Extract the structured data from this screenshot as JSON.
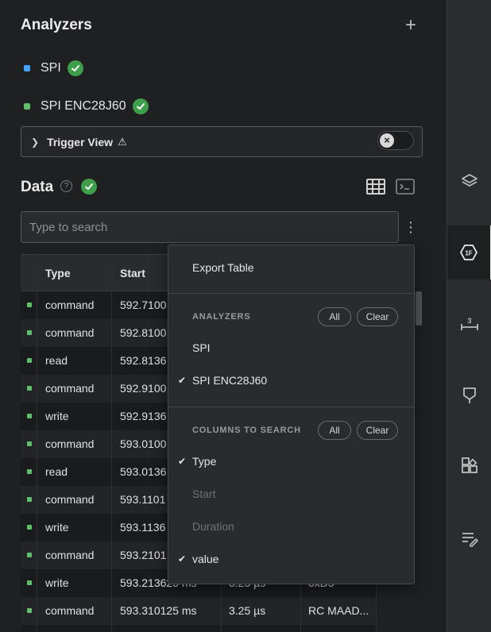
{
  "analyzers": {
    "title": "Analyzers",
    "add_icon": "plus-icon",
    "items": [
      {
        "label": "SPI",
        "color": "#4aa3ff"
      },
      {
        "label": "SPI ENC28J60",
        "color": "#5fbf6a"
      }
    ]
  },
  "trigger_view": {
    "label": "Trigger View",
    "warning_glyph": "⚠"
  },
  "data": {
    "title": "Data",
    "help_glyph": "?",
    "search_placeholder": "Type to search"
  },
  "table": {
    "columns": [
      "Type",
      "Start"
    ],
    "rows": [
      {
        "type": "command",
        "start": "592.7100",
        "duration": "",
        "value": ""
      },
      {
        "type": "command",
        "start": "592.8100",
        "duration": "",
        "value": ""
      },
      {
        "type": "read",
        "start": "592.8136",
        "duration": "",
        "value": ""
      },
      {
        "type": "command",
        "start": "592.9100",
        "duration": "",
        "value": ""
      },
      {
        "type": "write",
        "start": "592.9136",
        "duration": "",
        "value": ""
      },
      {
        "type": "command",
        "start": "593.0100",
        "duration": "",
        "value": ""
      },
      {
        "type": "read",
        "start": "593.0136",
        "duration": "",
        "value": ""
      },
      {
        "type": "command",
        "start": "593.1101",
        "duration": "",
        "value": ""
      },
      {
        "type": "write",
        "start": "593.1136",
        "duration": "",
        "value": ""
      },
      {
        "type": "command",
        "start": "593.2101",
        "duration": "",
        "value": ""
      },
      {
        "type": "write",
        "start": "593.213625 ms",
        "duration": "3.25 µs",
        "value": "0xD5"
      },
      {
        "type": "command",
        "start": "593.310125 ms",
        "duration": "3.25 µs",
        "value": "RC MAAD..."
      }
    ]
  },
  "menu": {
    "export_label": "Export Table",
    "analyzers_header": "ANALYZERS",
    "all_label": "All",
    "clear_label": "Clear",
    "analyzer_options": [
      {
        "label": "SPI",
        "checked": false
      },
      {
        "label": "SPI ENC28J60",
        "checked": true
      }
    ],
    "columns_header": "COLUMNS TO SEARCH",
    "column_options": [
      {
        "label": "Type",
        "checked": true,
        "disabled": false
      },
      {
        "label": "Start",
        "checked": false,
        "disabled": true
      },
      {
        "label": "Duration",
        "checked": false,
        "disabled": true
      },
      {
        "label": "value",
        "checked": true,
        "disabled": false
      }
    ],
    "check_glyph": "✔"
  },
  "rail": {
    "items": [
      {
        "icon": "layers-icon",
        "active": false
      },
      {
        "icon": "hex-analyzer-icon",
        "label": "1F",
        "active": true
      },
      {
        "icon": "measure-icon",
        "label": "3",
        "active": false
      },
      {
        "icon": "marker-icon",
        "active": false
      },
      {
        "icon": "extensions-icon",
        "active": false
      },
      {
        "icon": "notes-icon",
        "active": false
      }
    ]
  }
}
